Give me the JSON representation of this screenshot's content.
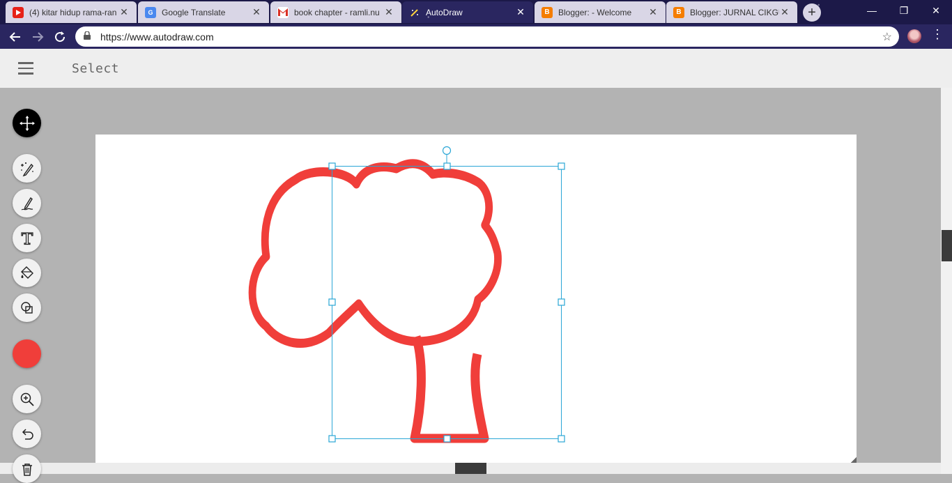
{
  "browser": {
    "tabs": [
      {
        "title": "(4) kitar hidup rama-ran",
        "icon": "youtube-icon",
        "active": false
      },
      {
        "title": "Google Translate",
        "icon": "google-translate-icon",
        "active": false
      },
      {
        "title": "book chapter - ramli.nu",
        "icon": "gmail-icon",
        "active": false
      },
      {
        "title": "AutoDraw",
        "icon": "autodraw-icon",
        "active": true
      },
      {
        "title": "Blogger: - Welcome",
        "icon": "blogger-icon",
        "active": false
      },
      {
        "title": "Blogger: JURNAL CIKGU",
        "icon": "blogger-icon",
        "active": false
      }
    ],
    "url": "https://www.autodraw.com"
  },
  "app": {
    "mode_title": "Select",
    "tools": [
      "move-tool",
      "autodraw-tool",
      "draw-tool",
      "type-tool",
      "fill-tool",
      "shape-tool"
    ],
    "selected_tool": "move-tool",
    "current_color": "#f03e3a",
    "accent": "#2aa6d6"
  },
  "drawing": {
    "subject": "tree",
    "stroke_color": "#f03e3a"
  }
}
